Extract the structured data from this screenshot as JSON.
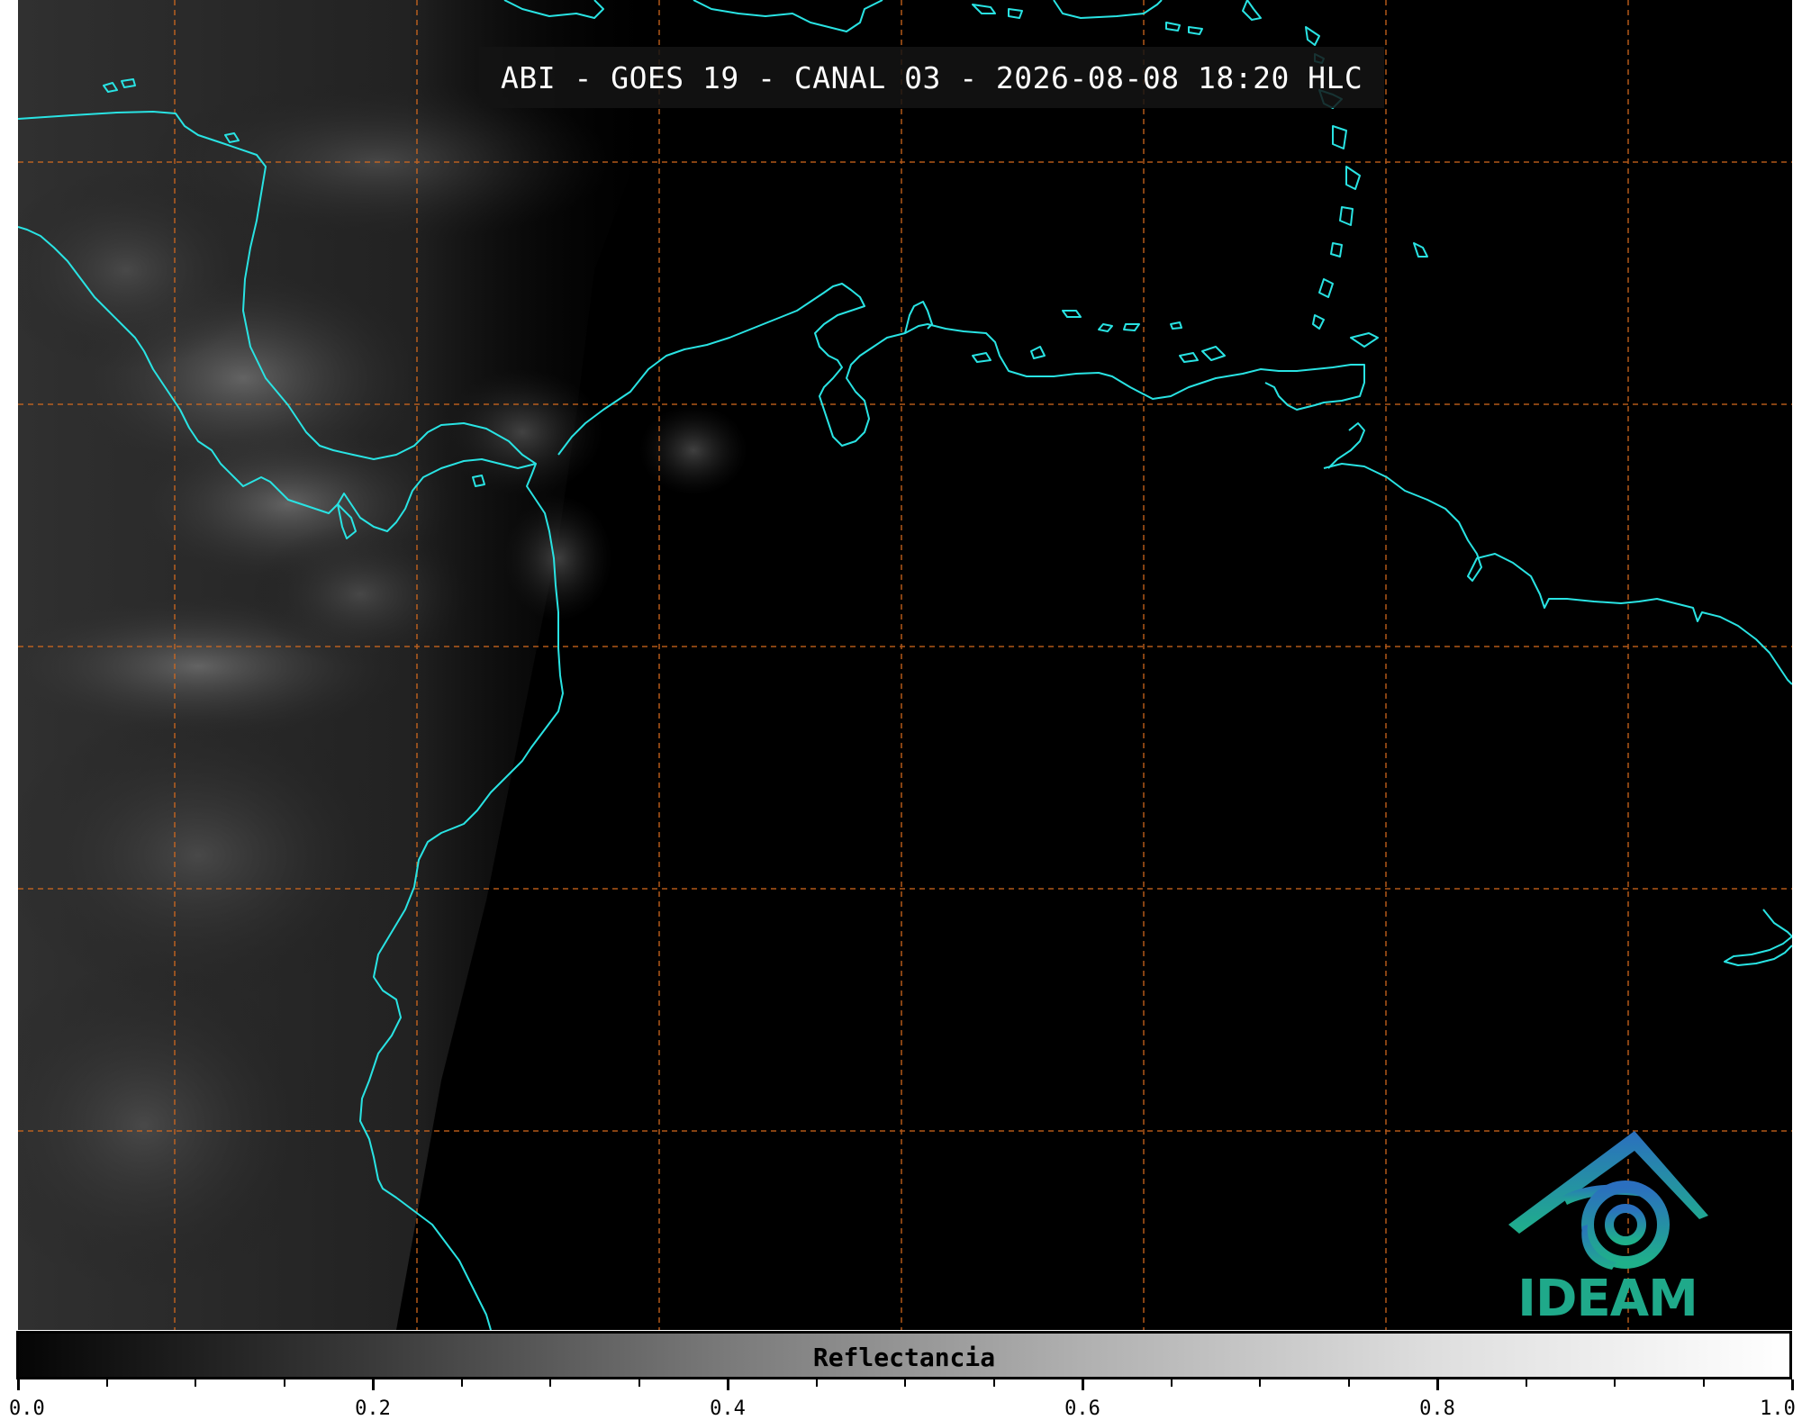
{
  "title": "ABI - GOES 19 - CANAL 03 - 2026-08-08 18:20 HLC",
  "colorbar": {
    "label": "Reflectancia",
    "range": [
      0.0,
      1.0
    ],
    "ticks": [
      "0.0",
      "0.2",
      "0.4",
      "0.6",
      "0.8",
      "1.0"
    ],
    "minor_step": 0.05
  },
  "logo": {
    "text": "IDEAM",
    "color": "#1fa98a"
  },
  "colors": {
    "background": "#000000",
    "coastline": "#29e3e3",
    "gridline": "#d2691e",
    "title_text": "#ffffff"
  }
}
